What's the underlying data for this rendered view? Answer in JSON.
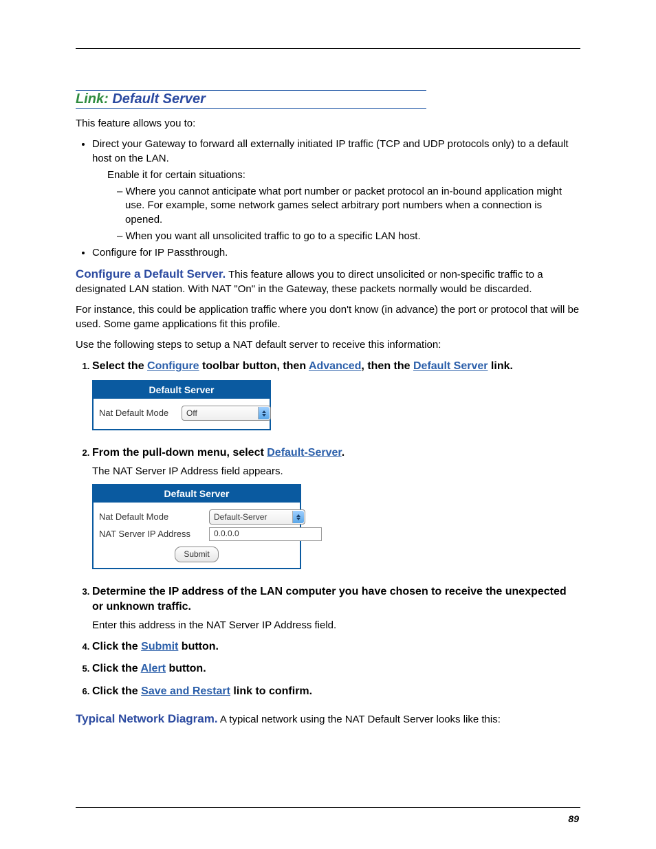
{
  "page_number": "89",
  "section": {
    "link_word": "Link:",
    "title_rest": " Default Server"
  },
  "intro": "This feature allows you to:",
  "bullets": {
    "b1": "Direct your Gateway to forward all externally initiated IP traffic (TCP and UDP protocols only) to a default host on the LAN.",
    "b1_sub": "Enable it for certain situations:",
    "b1_dash1": "– Where you cannot anticipate what port number or packet protocol an in-bound application might use. For example, some network games select arbitrary port numbers when a connection is opened.",
    "b1_dash2": "– When you want all unsolicited traffic to go to a specific LAN host.",
    "b2": "Configure for IP Passthrough."
  },
  "configure": {
    "head": "Configure a Default Server.",
    "body": " This feature allows you to direct unsolicited or non-specific traffic to a designated LAN station. With NAT \"On\" in the Gateway, these packets normally would be discarded."
  },
  "para_instance": "For instance, this could be application traffic where you don't know (in advance) the port or protocol that will be used. Some game applications fit this profile.",
  "para_steps_intro": "Use the following steps to setup a NAT default server to receive this information:",
  "steps": {
    "s1": {
      "pre": "Select the ",
      "link1": "Configure",
      "mid1": " toolbar button, then ",
      "link2": "Advanced",
      "mid2": ", then the ",
      "link3": "Default Server",
      "post": " link."
    },
    "s2": {
      "pre": "From the pull-down menu, select ",
      "link1": "Default-Server",
      "post": ".",
      "desc": "The NAT Server IP Address field appears."
    },
    "s3": {
      "bold": "Determine the IP address of the LAN computer you have chosen to receive the unexpected or unknown traffic.",
      "desc": "Enter this address in the NAT Server IP Address field."
    },
    "s4": {
      "pre": "Click the ",
      "link1": "Submit",
      "post": " button."
    },
    "s5": {
      "pre": "Click the ",
      "link1": "Alert",
      "post": " button."
    },
    "s6": {
      "pre": "Click the ",
      "link1": "Save and Restart",
      "post": " link to confirm."
    }
  },
  "panel1": {
    "title": "Default Server",
    "row1_label": "Nat Default Mode",
    "row1_value": "Off"
  },
  "panel2": {
    "title": "Default Server",
    "row1_label": "Nat Default Mode",
    "row1_value": "Default-Server",
    "row2_label": "NAT Server IP Address",
    "row2_value": "0.0.0.0",
    "submit": "Submit"
  },
  "typical": {
    "head": "Typical Network Diagram.",
    "body": " A typical network using the NAT Default Server looks like this:"
  }
}
